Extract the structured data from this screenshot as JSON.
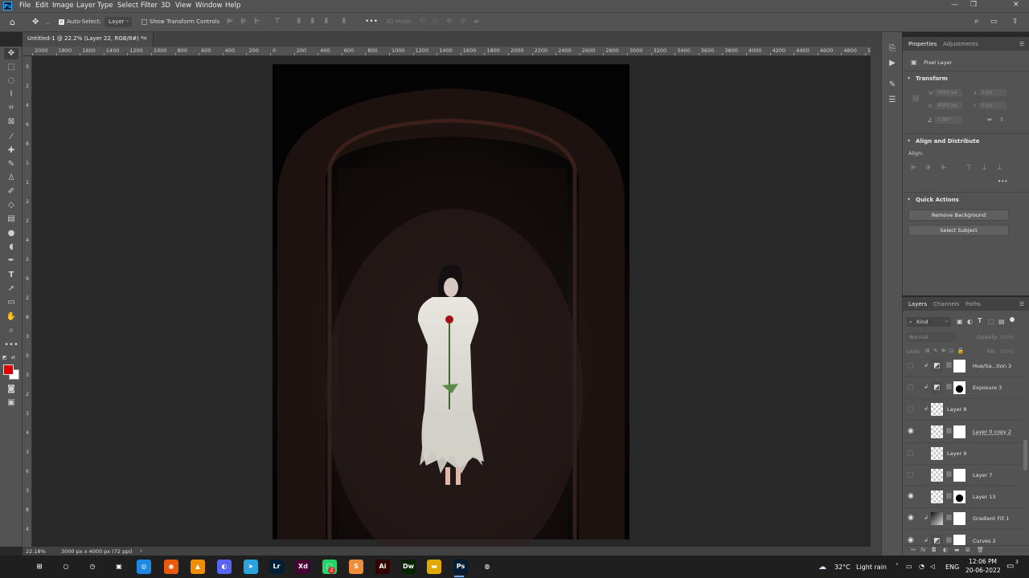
{
  "app": {
    "logo": "Ps"
  },
  "menu": [
    "File",
    "Edit",
    "Image",
    "Layer",
    "Type",
    "Select",
    "Filter",
    "3D",
    "View",
    "Window",
    "Help"
  ],
  "window_controls": {
    "minimize": "—",
    "restore": "❐",
    "close": "✕"
  },
  "options_bar": {
    "auto_select_label": "Auto-Select:",
    "auto_select_checked": true,
    "target": "Layer",
    "show_transform_label": "Show Transform Controls",
    "mode_3d": "3D Mode:"
  },
  "document": {
    "tab_title": "Untitled-1 @ 22.2% (Layer 22, RGB/8#) *",
    "close": "×"
  },
  "ruler": {
    "horizontal": [
      "2000",
      "1800",
      "1600",
      "1400",
      "1200",
      "1000",
      "800",
      "600",
      "400",
      "200",
      "0",
      "200",
      "400",
      "600",
      "800",
      "1000",
      "1200",
      "1400",
      "1600",
      "1800",
      "2000",
      "2200",
      "2400",
      "2600",
      "2800",
      "3000",
      "3200",
      "3400",
      "3600",
      "3800",
      "4000",
      "4200",
      "4400",
      "4600",
      "4800",
      "5000",
      "5200"
    ],
    "vertical": [
      "0",
      "2",
      "4",
      "6",
      "8",
      "1",
      "1",
      "2",
      "2",
      "4",
      "2",
      "6",
      "2",
      "8",
      "3",
      "0",
      "3",
      "2",
      "3",
      "4",
      "3",
      "6",
      "3",
      "8",
      "4"
    ]
  },
  "status": {
    "zoom": "22.18%",
    "doc_size": "3000 px x 4000 px (72 ppi)",
    "arrow": "›"
  },
  "properties": {
    "tab_active": "Properties",
    "tab_inactive": "Adjustments",
    "layer_type": "Pixel Layer",
    "transform": {
      "title": "Transform",
      "w_label": "W",
      "w_value": "3000 px",
      "x_label": "X",
      "x_value": "0 px",
      "h_label": "H",
      "h_value": "4000 px",
      "y_label": "Y",
      "y_value": "0 px",
      "angle_value": "0.00°"
    },
    "align": {
      "title": "Align and Distribute",
      "label": "Align:",
      "more": "•••"
    },
    "quick_actions": {
      "title": "Quick Actions",
      "remove_bg": "Remove Background",
      "select_subject": "Select Subject"
    }
  },
  "layers_panel": {
    "tabs": [
      "Layers",
      "Channels",
      "Paths"
    ],
    "filter_kind": "Kind",
    "blend_mode": "Normal",
    "opacity_label": "Opacity:",
    "opacity_value": "100%",
    "lock_label": "Lock:",
    "fill_label": "Fill:",
    "fill_value": "100%",
    "layers": [
      {
        "name": "Hue/Sa...tion 3",
        "visible": false,
        "clipped": true,
        "kind": "adjustment",
        "mask": "white"
      },
      {
        "name": "Exposure 3",
        "visible": false,
        "clipped": true,
        "kind": "adjustment",
        "mask": "figure"
      },
      {
        "name": "Layer 8",
        "visible": false,
        "clipped": true,
        "kind": "pixel",
        "mask": "none"
      },
      {
        "name": "Layer 0 copy 2",
        "visible": true,
        "clipped": false,
        "kind": "pixel",
        "mask": "white"
      },
      {
        "name": "Layer 9",
        "visible": false,
        "clipped": false,
        "kind": "pixel",
        "mask": "none"
      },
      {
        "name": "Layer 7",
        "visible": false,
        "clipped": false,
        "kind": "pixel",
        "mask": "white"
      },
      {
        "name": "Layer 13",
        "visible": true,
        "clipped": false,
        "kind": "pixel",
        "mask": "figure"
      },
      {
        "name": "Gradient Fill 1",
        "visible": true,
        "clipped": true,
        "kind": "gradient",
        "mask": "white"
      },
      {
        "name": "Curves 2",
        "visible": true,
        "clipped": true,
        "kind": "adjustment",
        "mask": "white"
      }
    ]
  },
  "taskbar": {
    "apps": [
      {
        "name": "start",
        "label": "⊞",
        "color": "#1f1f1f"
      },
      {
        "name": "search",
        "label": "○",
        "color": "#1f1f1f"
      },
      {
        "name": "clock-app",
        "label": "◷",
        "color": "#1f1f1f"
      },
      {
        "name": "media",
        "label": "▣",
        "color": "#1f1f1f"
      },
      {
        "name": "safari",
        "label": "◎",
        "color": "#1e88e5"
      },
      {
        "name": "firefox",
        "label": "◉",
        "color": "#e8590c"
      },
      {
        "name": "vlc",
        "label": "▲",
        "color": "#f08c00"
      },
      {
        "name": "discord",
        "label": "◐",
        "color": "#5865f2"
      },
      {
        "name": "telegram",
        "label": "➤",
        "color": "#2aa3de"
      },
      {
        "name": "lightroom",
        "label": "Lr",
        "color": "#001e36"
      },
      {
        "name": "xd",
        "label": "Xd",
        "color": "#470137"
      },
      {
        "name": "after-effects",
        "label": "Ae",
        "color": "#00005b"
      },
      {
        "name": "whatsapp",
        "label": "◯",
        "color": "#25d366"
      },
      {
        "name": "sublime",
        "label": "S",
        "color": "#f08c3a"
      },
      {
        "name": "illustrator",
        "label": "Ai",
        "color": "#330000"
      },
      {
        "name": "dreamweaver",
        "label": "Dw",
        "color": "#072401"
      },
      {
        "name": "explorer",
        "label": "▬",
        "color": "#e0a800"
      },
      {
        "name": "photoshop",
        "label": "Ps",
        "color": "#001e36"
      },
      {
        "name": "chrome",
        "label": "◍",
        "color": "#1f1f1f"
      }
    ],
    "whatsapp_badge": "2",
    "weather_temp": "32°C",
    "weather_text": "Light rain",
    "lang": "ENG",
    "time": "12:06 PM",
    "date": "20-06-2022",
    "notif_count": "3"
  },
  "colors": {
    "foreground": "#e00000",
    "background": "#ffffff",
    "ui_bg": "#535353",
    "canvas_bg": "#282828"
  }
}
